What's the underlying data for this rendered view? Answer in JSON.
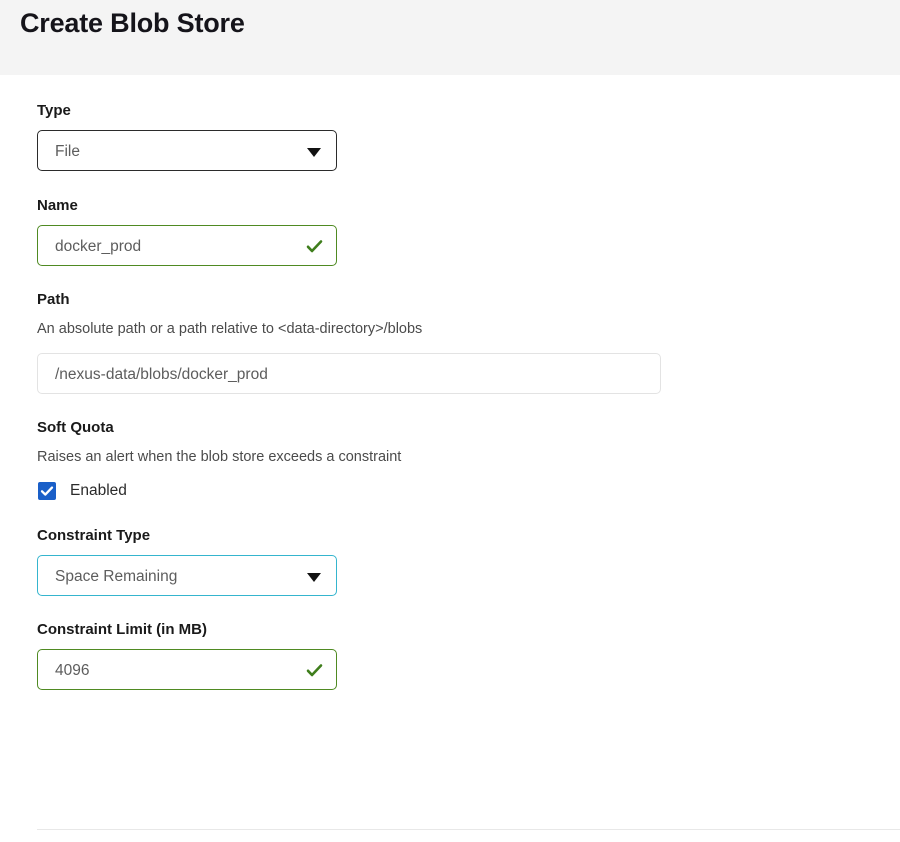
{
  "header": {
    "title": "Create Blob Store"
  },
  "form": {
    "type": {
      "label": "Type",
      "value": "File",
      "caret_icon": "chevron-down-icon"
    },
    "name": {
      "label": "Name",
      "value": "docker_prod",
      "status_icon": "check-icon",
      "status_color": "#4f8a22"
    },
    "path": {
      "label": "Path",
      "description": "An absolute path or a path relative to <data-directory>/blobs",
      "value": "/nexus-data/blobs/docker_prod"
    },
    "soft_quota": {
      "label": "Soft Quota",
      "description": "Raises an alert when the blob store exceeds a constraint",
      "enabled_label": "Enabled",
      "enabled": true,
      "checkbox_color": "#1a5fc8"
    },
    "constraint_type": {
      "label": "Constraint Type",
      "value": "Space Remaining",
      "caret_icon": "chevron-down-icon",
      "focus_color": "#35b5ce"
    },
    "constraint_limit": {
      "label": "Constraint Limit (in MB)",
      "value": "4096",
      "status_icon": "check-icon",
      "status_color": "#4f8a22"
    }
  }
}
